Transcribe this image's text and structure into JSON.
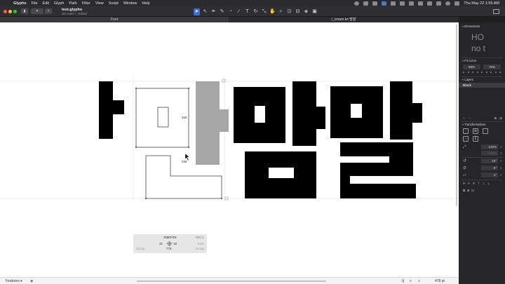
{
  "menubar": {
    "app": "Glyphs",
    "menus": [
      "File",
      "Edit",
      "Glyph",
      "Path",
      "Filter",
      "View",
      "Script",
      "Window",
      "Help"
    ],
    "clock": "Thu May 22  1:55 AM"
  },
  "window": {
    "title": "test.glyphs",
    "subtitle": "Jun Kaes — Edited"
  },
  "tabs": [
    {
      "label": "Font",
      "active": false
    },
    {
      "label": "/_cmam.ko 맘말",
      "active": true
    }
  ],
  "canvas": {
    "measure_top": "468",
    "measure_bottom": "236"
  },
  "info": {
    "glyph_name": "mam-ko",
    "unicode": "B9CC",
    "lsb": "31",
    "rsb": "18",
    "width": "778",
    "kern_label": "Kern",
    "group_left": "Group",
    "group_right": "Group"
  },
  "bottom": {
    "features_label": "Features",
    "font_size": "478 pt"
  },
  "panel": {
    "dimensions_title": "Dimensions",
    "dim_big_1": "HO",
    "dim_big_2": "no  t",
    "fit_title": "Fit Curve",
    "fit_left": "58%",
    "fit_right": "75%",
    "layers_title": "Layers",
    "layer_name": "Black",
    "transform_title": "Transformations",
    "scale_value": "120%",
    "scale_dim": "100%",
    "rotate_value": "10°",
    "slant_value": "5°",
    "skew_value": "1°"
  }
}
